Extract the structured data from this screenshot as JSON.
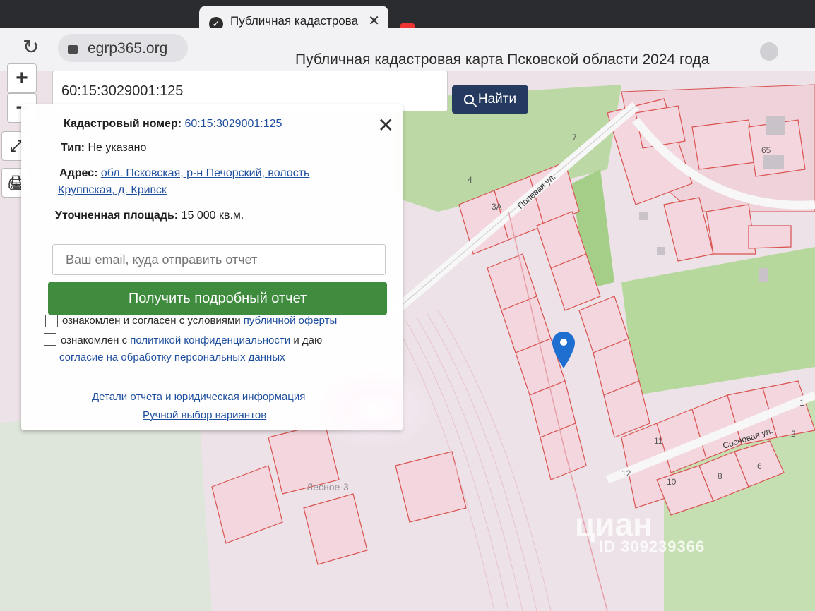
{
  "browser": {
    "tab_title": "Публичная кадастрова",
    "tab_close": "✕",
    "url": "egrp365.org",
    "window_title": "Публичная кадастровая карта Псковской области 2024 года"
  },
  "map_controls": {
    "zoom_in": "+",
    "zoom_out": "−",
    "fullscreen_icon": "⤢",
    "print_icon": "🖨"
  },
  "search": {
    "value": "60:15:3029001:125",
    "button_label": "Найти"
  },
  "popup": {
    "cadastral_label": "Кадастровый номер:",
    "cadastral_value": "60:15:3029001:125",
    "type_label": "Тип:",
    "type_value": "Не указано",
    "address_label": "Адрес:",
    "address_line1": "обл. Псковская, р-н Печорский, волость",
    "address_line2": "Круппская, д. Кривск",
    "area_label": "Уточненная площадь:",
    "area_value": "15 000 кв.м.",
    "email_placeholder": "Ваш email, куда отправить отчет",
    "report_button": "Получить подробный отчет",
    "consent1_text": "ознакомлен и согласен с условиями",
    "consent1_link": "публичной оферты",
    "consent2_text": "ознакомлен с",
    "consent2_link": "политикой конфиденциальности",
    "consent2_text2": "и даю",
    "consent2_line2": "согласие на обработку персональных данных",
    "details_link": "Детали отчета и юридическая информация",
    "manual_link": "Ручной выбор вариантов",
    "close": "✕"
  },
  "map_labels": {
    "street1": "Полевая ул.",
    "street2": "Сосновая ул.",
    "village": "Лесное-3",
    "plot_3a": "3А",
    "plot_4": "4",
    "plot_7": "7",
    "plot_65": "65",
    "plot_1": "1",
    "plot_2": "2",
    "plot_6": "6",
    "plot_8": "8",
    "plot_10": "10",
    "plot_11": "11",
    "plot_12": "12"
  },
  "watermark": {
    "logo": "циан",
    "id": "ID 309239366"
  },
  "colors": {
    "parcel_border": "#d9534f",
    "parcel_fill": "#f2d4dc",
    "green_area": "#a9d18e",
    "road": "#f7f7f7",
    "search_button": "#243a5e",
    "report_button": "#3f8c3f",
    "link": "#1e4e9e"
  }
}
